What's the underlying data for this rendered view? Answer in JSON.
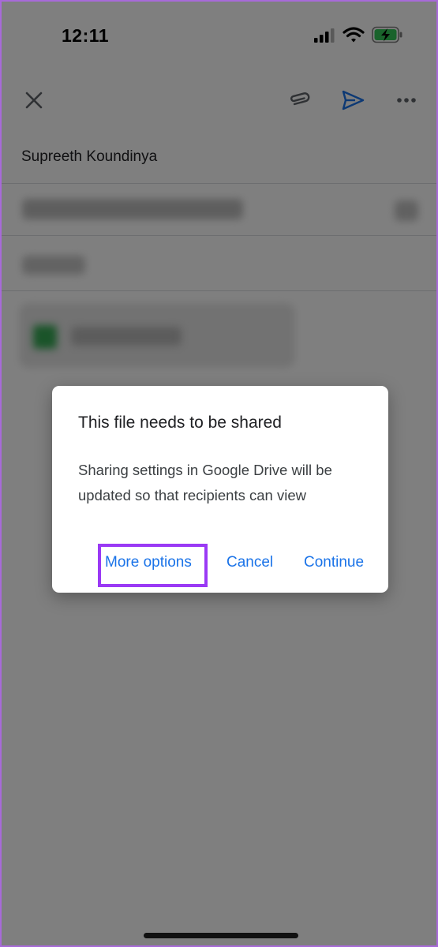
{
  "status_bar": {
    "time": "12:11"
  },
  "compose": {
    "from_name": "Supreeth Koundinya"
  },
  "dialog": {
    "title": "This file needs to be shared",
    "message": "Sharing settings in Google Drive will be updated so that recipients can view",
    "buttons": {
      "more_options": "More options",
      "cancel": "Cancel",
      "continue": "Continue"
    }
  },
  "colors": {
    "accent": "#1a73e8",
    "highlight": "#9a39f5",
    "scrim": "rgba(0,0,0,0.5)"
  },
  "icons": [
    "signal-icon",
    "wifi-icon",
    "battery-charging-icon",
    "close-icon",
    "attachment-icon",
    "send-icon",
    "more-vert-icon"
  ]
}
